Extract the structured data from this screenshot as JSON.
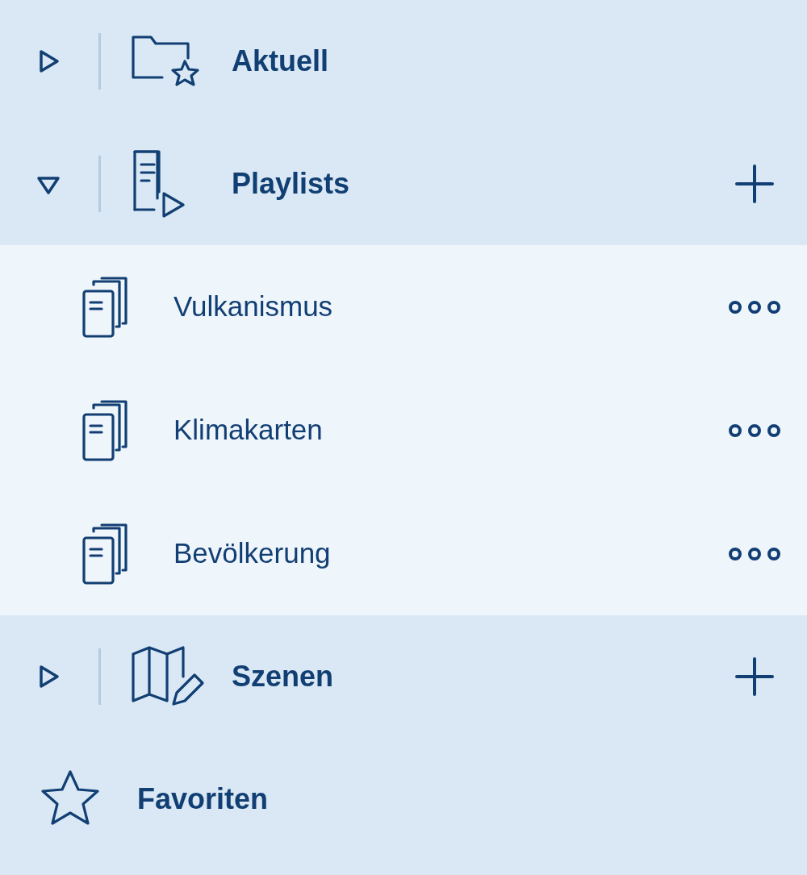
{
  "sections": [
    {
      "kind": "recent",
      "label": "Aktuell",
      "expanded": false,
      "addable": false
    },
    {
      "kind": "playlist",
      "label": "Playlists",
      "expanded": true,
      "addable": true,
      "children": [
        {
          "label": "Vulkanismus"
        },
        {
          "label": "Klimakarten"
        },
        {
          "label": "Bevölkerung"
        }
      ]
    },
    {
      "kind": "scenes",
      "label": "Szenen",
      "expanded": false,
      "addable": true
    },
    {
      "kind": "favorites",
      "label": "Favoriten",
      "addable": false
    }
  ]
}
